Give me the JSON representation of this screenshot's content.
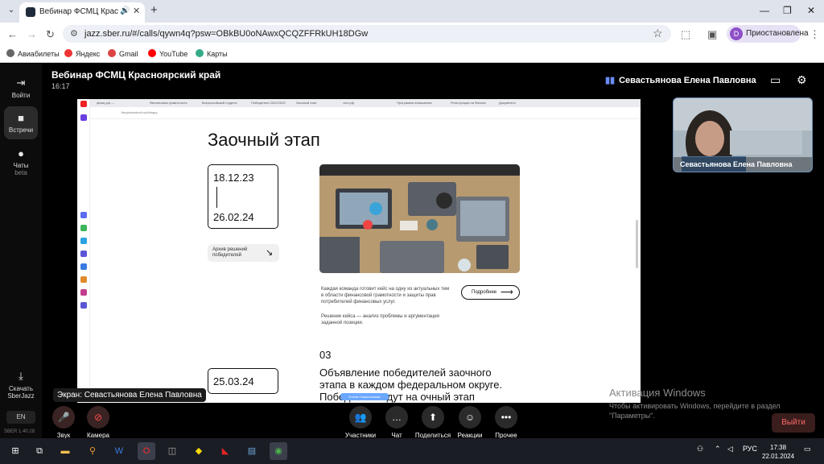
{
  "browser": {
    "tab_title": "Вебинар ФСМЦ Красноярский",
    "url": "jazz.sber.ru/#/calls/qywn4q?psw=OBkBU0oNAwxQCQZFFRkUH18DGw",
    "profile_label": "Приостановлена",
    "profile_initial": "D",
    "bookmarks": [
      "Авиабилеты",
      "Яндекс",
      "Gmail",
      "YouTube",
      "Карты"
    ]
  },
  "app": {
    "sidebar": {
      "exit": "Войти",
      "meetings": "Встречи",
      "chats": "Чаты",
      "chats_sub": "beta",
      "download": "Скачать",
      "download_sub": "SberJazz",
      "lang": "EN",
      "version": "SBER 1.40.28"
    },
    "meeting_title": "Вебинар ФСМЦ Красноярский край",
    "meeting_time": "16:17",
    "active_speaker": "Севастьянова Елена Павловна",
    "screen_label": "Экран: Севастьянова Елена Павловна",
    "video_name": "Севастьянова Елена Павловна",
    "controls": {
      "sound": "Звук",
      "camera": "Камера",
      "participants": "Участники",
      "chat": "Чат",
      "share": "Поделиться",
      "reactions": "Реакции",
      "more": "Прочее",
      "leave": "Выйти"
    }
  },
  "shared": {
    "tabs": [
      "фсмц.рф —",
      "Финансовая грамотность",
      "Всероссийский студенч",
      "Победители 2022/2023",
      "Заочный этап",
      "тест.рф",
      "Программа повышения",
      "Регистрация на Финанс",
      "Документы"
    ],
    "url": "fincyberschool.ru/#/etapy",
    "section_title": "Заочный этап",
    "date_start": "18.12.23",
    "date_end": "26.02.24",
    "archive_label": "Архив решений победителей",
    "desc1": "Каждая команда готовит кейс на одну из актуальных тем в области финансовой грамотности и защиты прав потребителей финансовых услуг.",
    "desc2": "Решение кейса — анализ проблемы и аргументация заданной позиции.",
    "more_label": "Подробнее",
    "step_num": "03",
    "date_result": "25.03.24",
    "announce": "Объявление победителей заочного этапа в каждом федеральном округе. Победители едут на очный этап",
    "cursor_label": "Елена Севастьянова"
  },
  "watermark": {
    "line1": "Активация Windows",
    "line2": "Чтобы активировать Windows, перейдите в раздел \"Параметры\"."
  },
  "taskbar": {
    "lang": "РУС",
    "time": "17:38",
    "date": "22.01.2024"
  }
}
